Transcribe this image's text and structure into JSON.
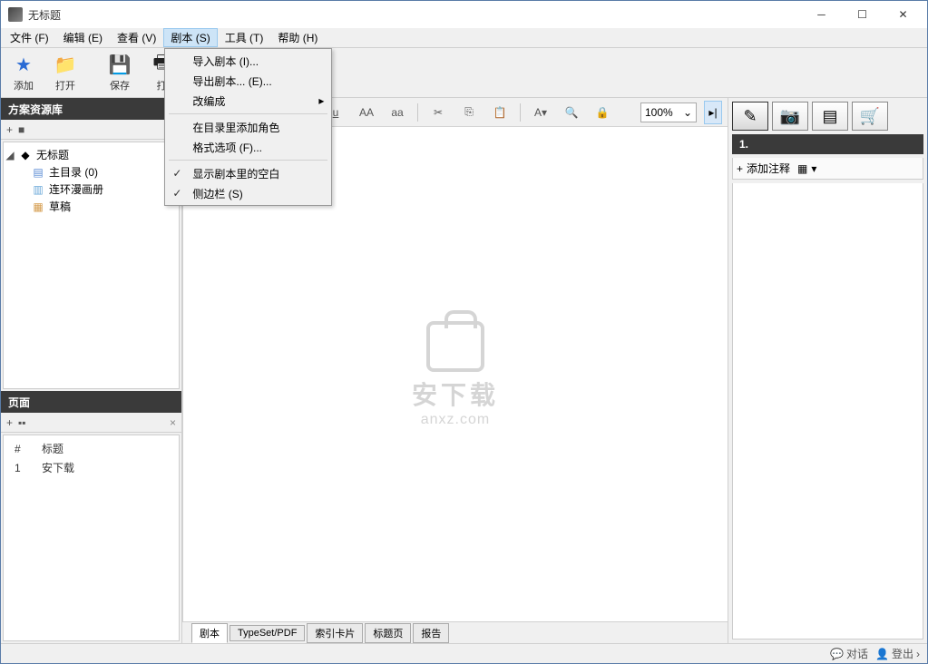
{
  "window": {
    "title": "无标题"
  },
  "menubar": {
    "file": "文件 (F)",
    "edit": "编辑 (E)",
    "view": "查看 (V)",
    "script": "剧本 (S)",
    "tools": "工具 (T)",
    "help": "帮助 (H)"
  },
  "dropdown": {
    "import_script": "导入剧本 (I)...",
    "export_script": "导出剧本... (E)...",
    "recompile": "改编成",
    "add_role": "在目录里添加角色",
    "format_options": "格式选项 (F)...",
    "show_blank": "显示剧本里的空白",
    "sidebar": "侧边栏 (S)"
  },
  "toolbar": {
    "add": "添加",
    "open": "打开",
    "save": "保存",
    "print": "打"
  },
  "format": {
    "zoom": "100%"
  },
  "left": {
    "project_panel_title": "方案资源库",
    "page_panel_title": "页面",
    "tree": {
      "root": "无标题",
      "main_dir": "主目录 (0)",
      "comic": "连环漫画册",
      "draft": "草稿"
    },
    "page_table": {
      "col_num": "#",
      "col_title": "标题",
      "rows": [
        {
          "num": "1",
          "title": "安下载"
        }
      ]
    }
  },
  "editor": {
    "sample_text_suffix": "下载"
  },
  "right": {
    "section_number": "1.",
    "add_note": "添加注释"
  },
  "bottom_tabs": {
    "script": "剧本",
    "typeset": "TypeSet/PDF",
    "index": "索引卡片",
    "title_page": "标题页",
    "report": "报告"
  },
  "status": {
    "chat": "对话",
    "logout": "登出"
  },
  "watermark": {
    "big": "安下载",
    "small": "anxz.com"
  }
}
